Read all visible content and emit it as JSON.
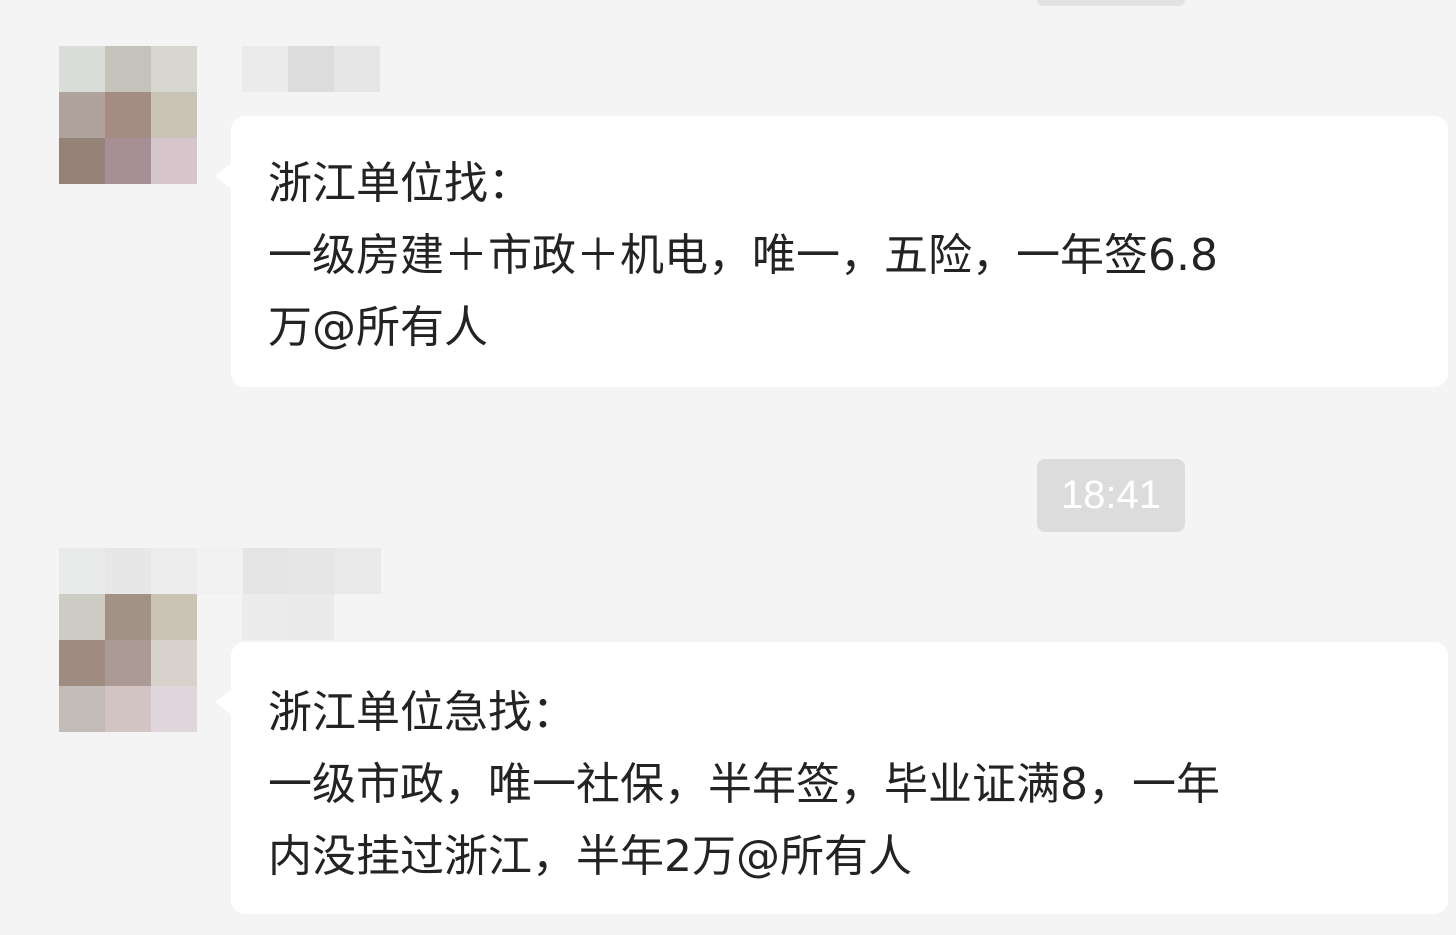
{
  "messages": [
    {
      "lines": [
        "浙江单位找：",
        "一级房建＋市政＋机电，唯一，五险，一年签6.8",
        "万@所有人"
      ]
    },
    {
      "timestamp": "18:41",
      "lines": [
        "浙江单位急找：",
        "一级市政，唯一社保，半年签，毕业证满8，一年",
        "内没挂过浙江，半年2万@所有人"
      ]
    }
  ],
  "colors": {
    "background": "#f4f4f4",
    "bubble": "#ffffff",
    "text": "#232323",
    "timestamp_bg": "#dcdcdc",
    "timestamp_text": "#ffffff"
  },
  "icons": {
    "avatar_1": "pixelated-avatar-icon",
    "avatar_2": "pixelated-avatar-icon"
  }
}
